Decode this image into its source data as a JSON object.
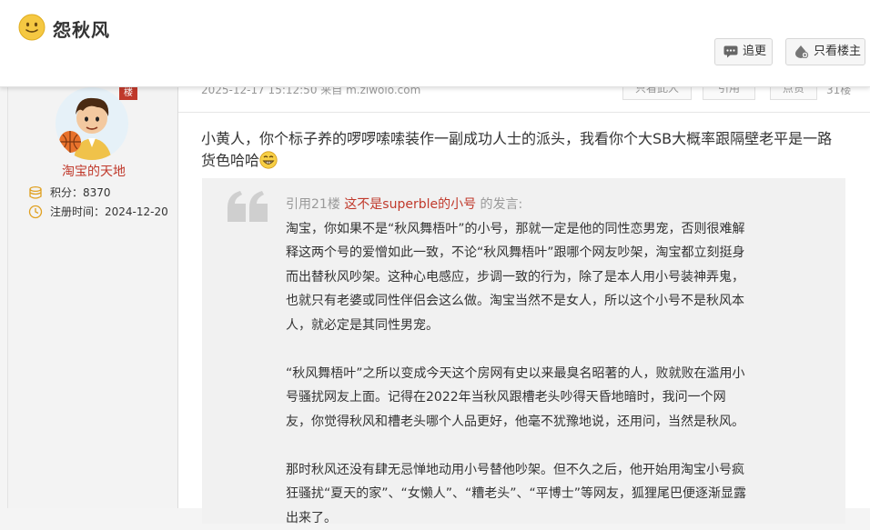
{
  "header": {
    "title": "怨秋风",
    "reply_label": "追更",
    "only_label": "只看楼主"
  },
  "post_bar": {
    "date": "2025-12-17 15:12:50 来自 m.ziwolo.com",
    "btn_report": "只看此人",
    "btn_quote": "引用",
    "btn_like": "点赞",
    "floor": "31楼"
  },
  "author": {
    "name": "淘宝的天地",
    "floor_badge": "楼",
    "points_label": "积分：",
    "points_value": "8370",
    "reg_label": "注册时间：",
    "reg_value": "2024-12-20"
  },
  "post": {
    "text": "小黄人，你个标子养的啰啰嗦嗦装作一副成功人士的派头，我看你个大SB大概率跟隔壁老平是一路货色哈哈"
  },
  "quote": {
    "prefix": "引用21楼",
    "author": "这不是superble的小号",
    "suffix": "的发言:",
    "p1": "淘宝，你如果不是“秋风舞梧叶”的小号，那就一定是他的同性恋男宠，否则很难解释这两个号的爱憎如此一致，不论“秋风舞梧叶”跟哪个网友吵架，淘宝都立刻挺身而出替秋风吵架。这种心电感应，步调一致的行为，除了是本人用小号装神弄鬼，也就只有老婆或同性伴侣会这么做。淘宝当然不是女人，所以这个小号不是秋风本人，就必定是其同性男宠。",
    "p2": "“秋风舞梧叶”之所以变成今天这个房网有史以来最臭名昭著的人，败就败在滥用小号骚扰网友上面。记得在2022年当秋风跟槽老头吵得天昏地暗时，我问一个网友，你觉得秋风和槽老头哪个人品更好，他毫不犹豫地说，还用问，当然是秋风。",
    "p3": "那时秋风还没有肆无忌惮地动用小号替他吵架。但不久之后，他开始用淘宝小号疯狂骚扰“夏天的家”、“女懒人”、“糟老头”、“平博士”等网友，狐狸尾巴便逐渐显露出来了。"
  },
  "colors": {
    "accent_red": "#c0392b",
    "page_bg": "#f4f4f4",
    "quote_bg": "#f1f1f1"
  },
  "icons": {
    "logo": "smiley-face-icon",
    "reply": "comment-icon",
    "only": "user-drop-icon",
    "points": "coin-stack-icon",
    "reg": "clock-icon",
    "quote": "quote-mark-icon",
    "emoji": "grin-emoji-icon"
  }
}
